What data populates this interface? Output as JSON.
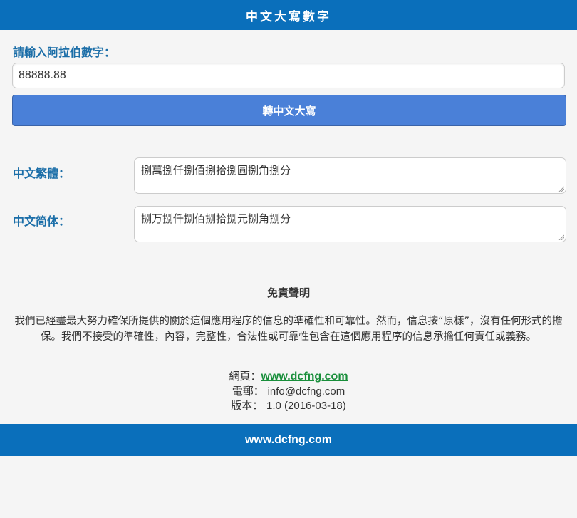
{
  "header": {
    "title": "中文大寫數字"
  },
  "form": {
    "input_label": "請輸入阿拉伯數字：",
    "input_value": "88888.88",
    "convert_button": "轉中文大寫"
  },
  "results": {
    "traditional_label": "中文繁體：",
    "traditional_value": "捌萬捌仟捌佰捌拾捌圓捌角捌分",
    "simplified_label": "中文简体：",
    "simplified_value": "捌万捌仟捌佰捌拾捌元捌角捌分"
  },
  "disclaimer": {
    "title": "免責聲明",
    "text": "我們已經盡最大努力確保所提供的關於這個應用程序的信息的準確性和可靠性。然而，信息按“原樣”，沒有任何形式的擔保。我們不接受的準確性，內容，完整性，合法性或可靠性包含在這個應用程序的信息承擔任何責任或義務。"
  },
  "info": {
    "web_label": "網頁：",
    "web_value": "www.dcfng.com",
    "email_label": "電郵：",
    "email_value": "info@dcfng.com",
    "version_label": "版本：",
    "version_value": "1.0 (2016-03-18)"
  },
  "footer": {
    "text": "www.dcfng.com"
  }
}
